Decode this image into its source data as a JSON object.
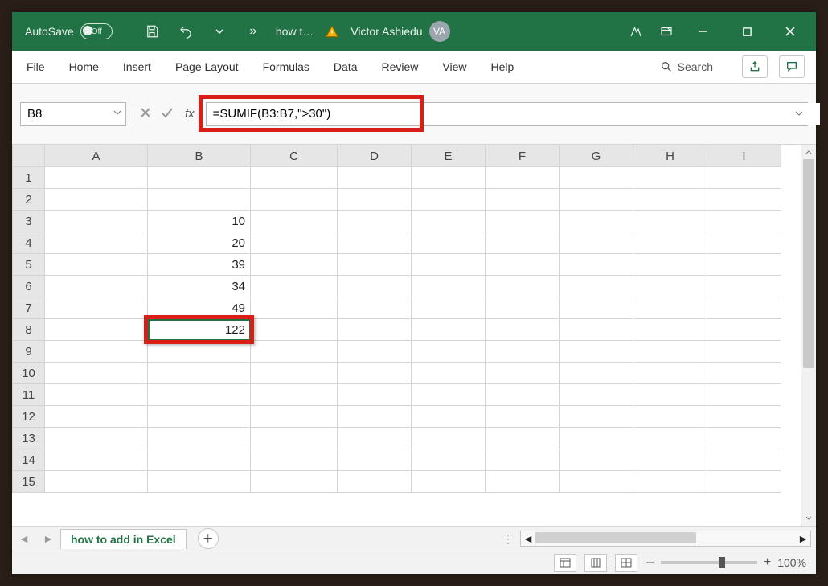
{
  "titlebar": {
    "autosave_label": "AutoSave",
    "autosave_state": "Off",
    "doc_title": "how t…",
    "more_symbol": "»",
    "user_name": "Victor Ashiedu",
    "user_initials": "VA"
  },
  "ribbon": {
    "tabs": [
      "File",
      "Home",
      "Insert",
      "Page Layout",
      "Formulas",
      "Data",
      "Review",
      "View",
      "Help"
    ],
    "search_label": "Search"
  },
  "formula_bar": {
    "cell_ref": "B8",
    "fx_label": "fx",
    "formula": "=SUMIF(B3:B7,\">30\")"
  },
  "grid": {
    "columns": [
      "A",
      "B",
      "C",
      "D",
      "E",
      "F",
      "G",
      "H",
      "I"
    ],
    "rows_visible": 15,
    "cells": {
      "B3": "10",
      "B4": "20",
      "B5": "39",
      "B6": "34",
      "B7": "49",
      "B8": "122"
    },
    "selected_cell": "B8"
  },
  "sheetbar": {
    "active_tab": "how to add in Excel"
  },
  "status": {
    "zoom_label": "100%",
    "zoom_minus": "−",
    "zoom_plus": "+"
  }
}
